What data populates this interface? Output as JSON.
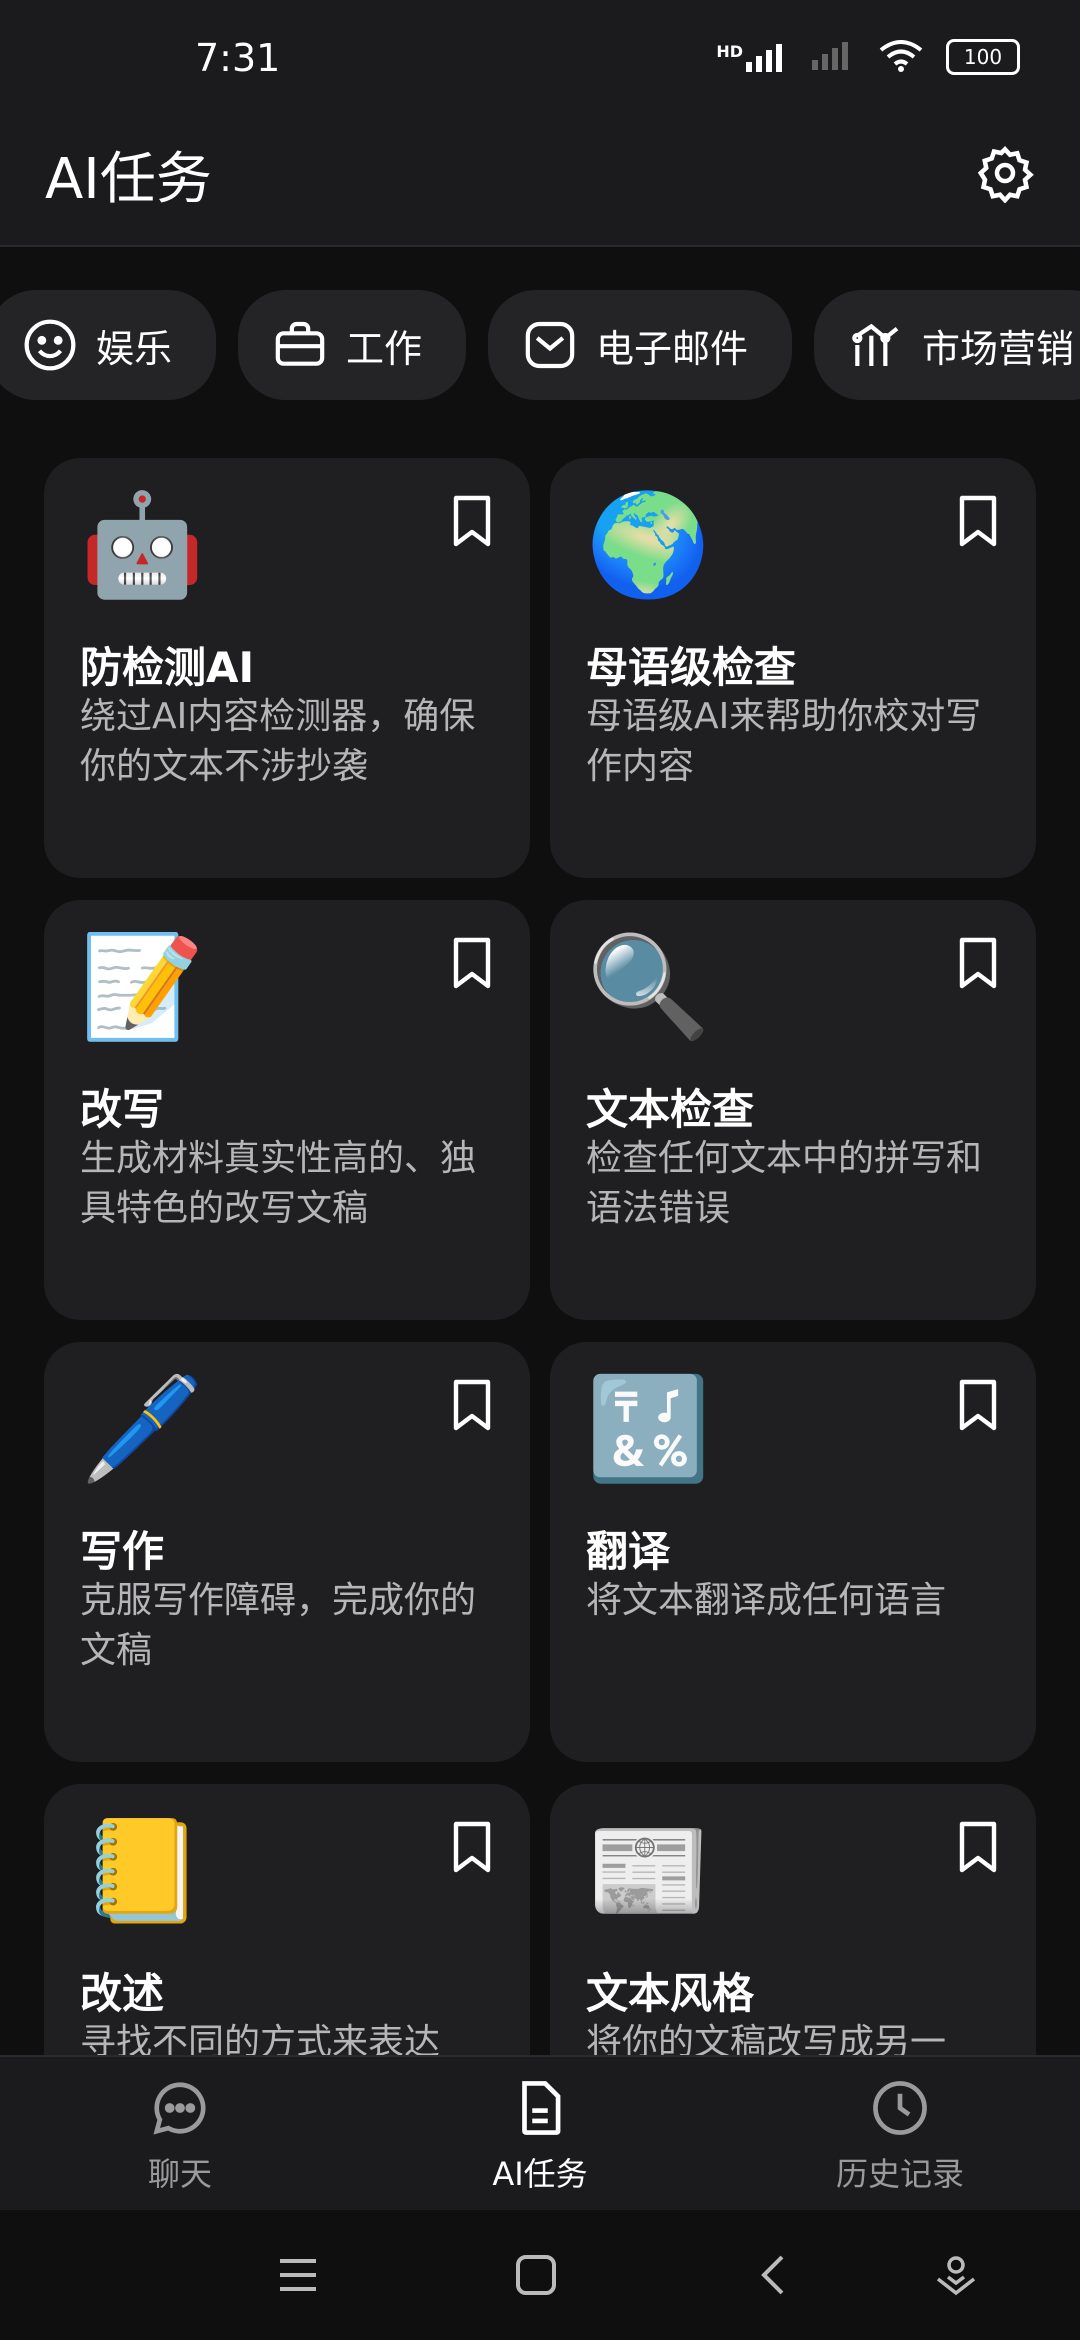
{
  "status_bar": {
    "time": "7:31",
    "network_label": "HD",
    "battery_level": "100"
  },
  "app_bar": {
    "title": "AI任务"
  },
  "categories": [
    {
      "label": "娱乐",
      "icon": "smile-icon"
    },
    {
      "label": "工作",
      "icon": "briefcase-icon"
    },
    {
      "label": "电子邮件",
      "icon": "mail-icon"
    },
    {
      "label": "市场营销",
      "icon": "marketing-icon"
    }
  ],
  "tasks": [
    {
      "emoji": "🤖",
      "title": "防检测AI",
      "desc": "绕过AI内容检测器，确保你的文本不涉抄袭"
    },
    {
      "emoji": "🌍",
      "title": "母语级检查",
      "desc": "母语级AI来帮助你校对写作内容"
    },
    {
      "emoji": "📝",
      "title": "改写",
      "desc": "生成材料真实性高的、独具特色的改写文稿"
    },
    {
      "emoji": "🔍",
      "title": "文本检查",
      "desc": "检查任何文本中的拼写和语法错误"
    },
    {
      "emoji": "🖊️",
      "title": "写作",
      "desc": "克服写作障碍，完成你的文稿"
    },
    {
      "emoji": "🔣",
      "title": "翻译",
      "desc": "将文本翻译成任何语言"
    },
    {
      "emoji": "📒",
      "title": "改述",
      "desc": "寻找不同的方式来表达"
    },
    {
      "emoji": "📰",
      "title": "文本风格",
      "desc": "将你的文稿改写成另一"
    }
  ],
  "bottom_nav": [
    {
      "label": "聊天",
      "icon": "chat-icon",
      "active": false
    },
    {
      "label": "AI任务",
      "icon": "document-icon",
      "active": true
    },
    {
      "label": "历史记录",
      "icon": "clock-icon",
      "active": false
    }
  ]
}
